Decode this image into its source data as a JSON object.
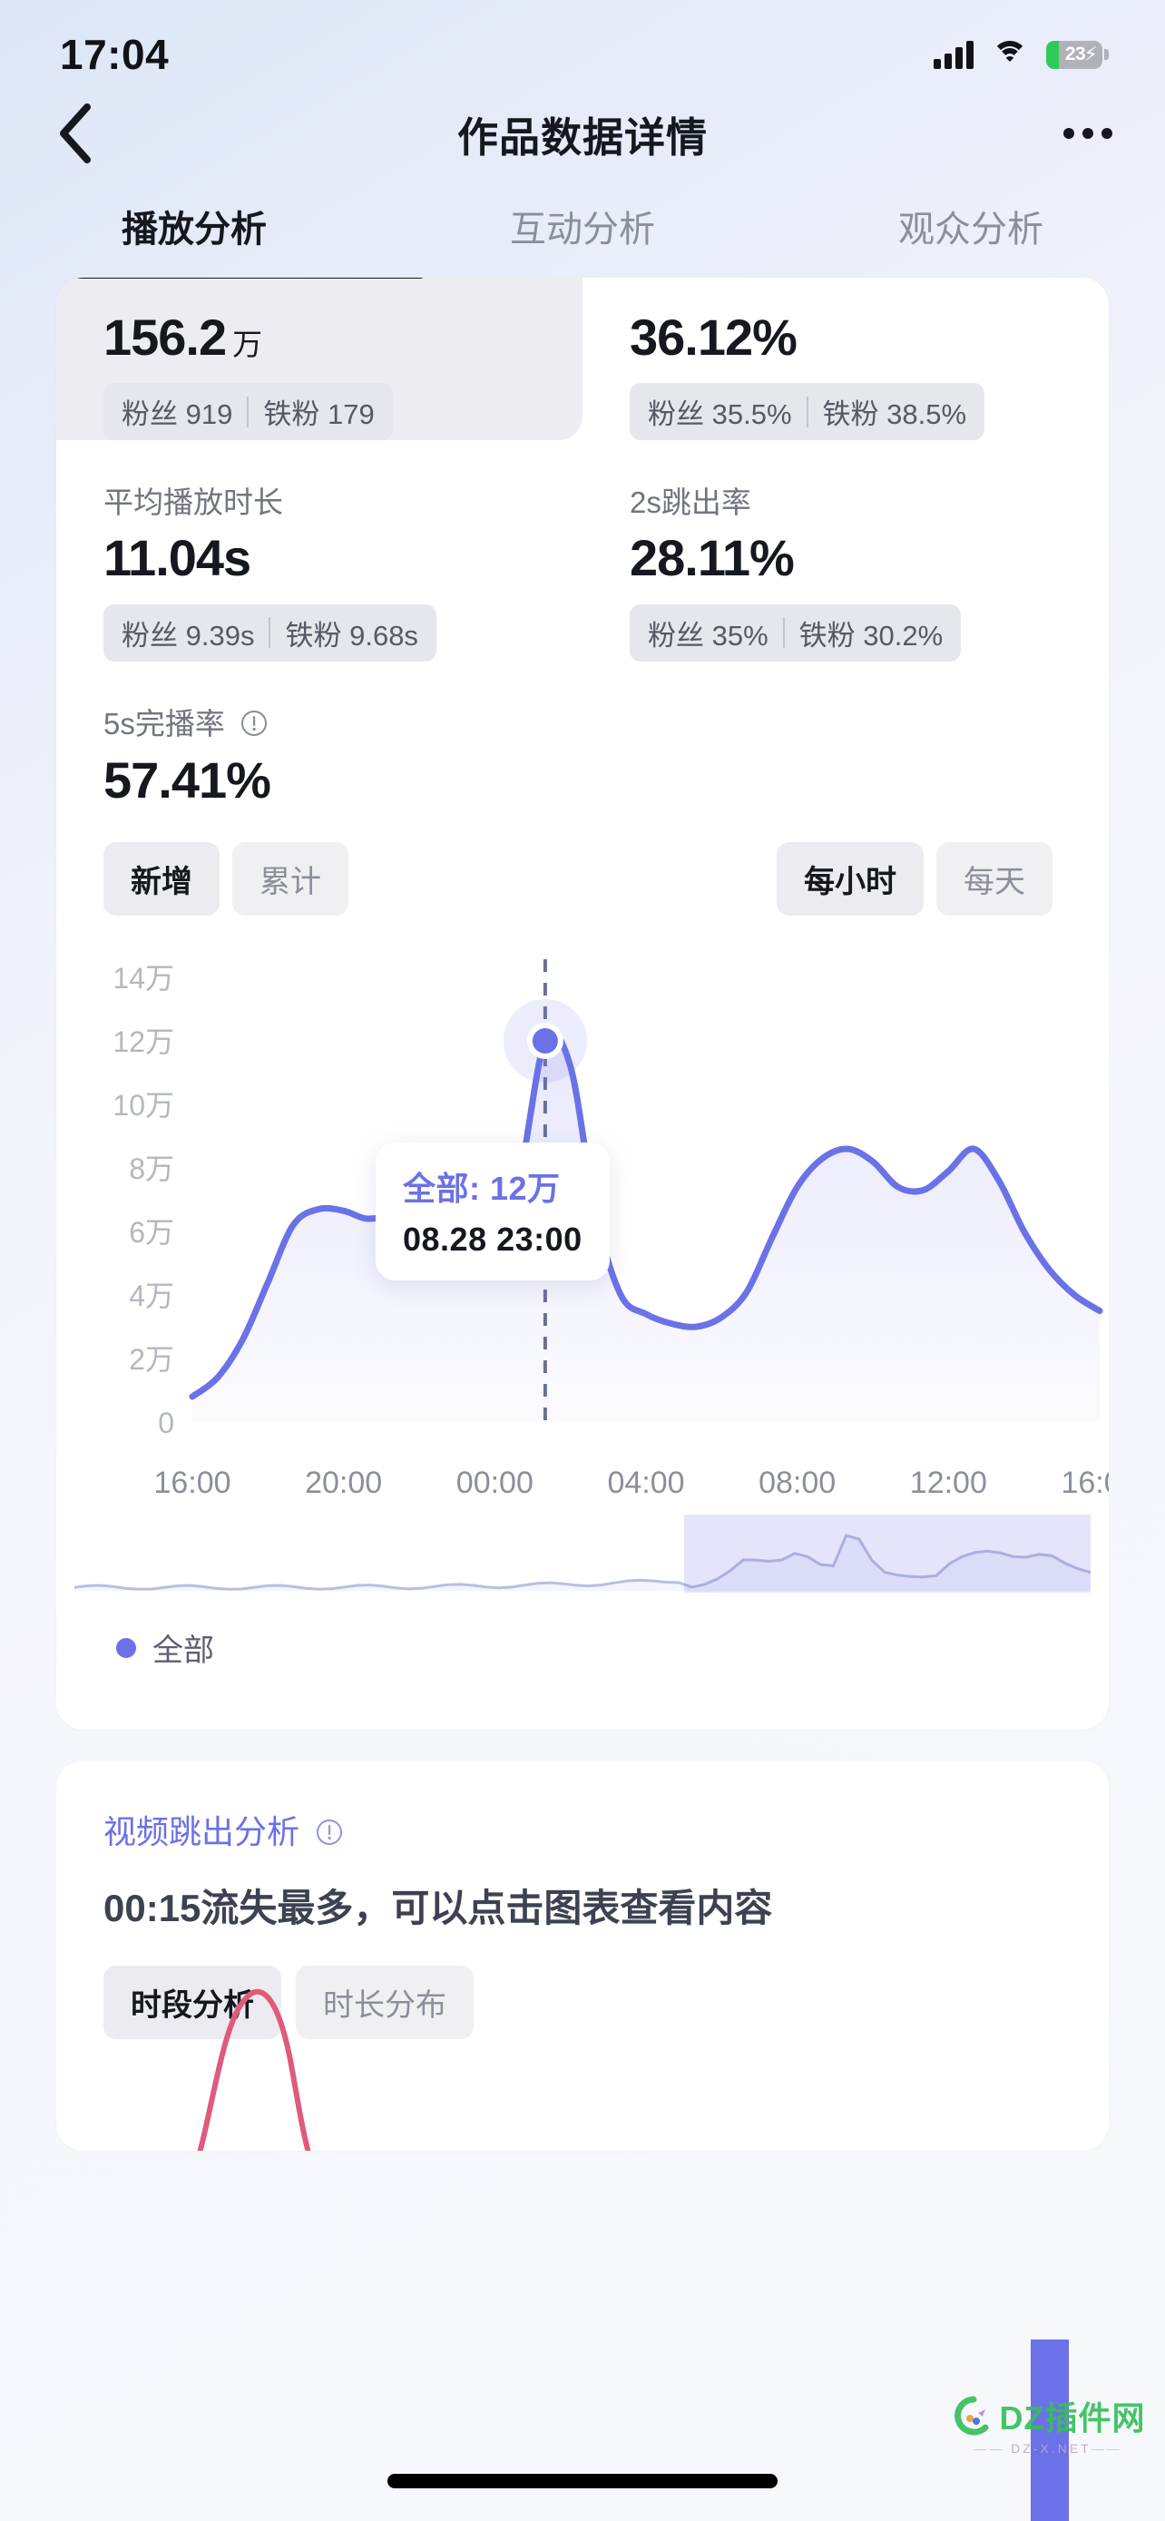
{
  "status_bar": {
    "time": "17:04",
    "battery_percent": "23",
    "battery_level": 23,
    "charging": true,
    "signal_icon": "cellular-signal-icon",
    "wifi_icon": "wifi-icon",
    "battery_icon": "battery-icon"
  },
  "nav": {
    "back_icon": "chevron-left-icon",
    "title": "作品数据详情",
    "more_icon": "more-horizontal-icon"
  },
  "tabs": [
    {
      "label": "播放分析",
      "active": true
    },
    {
      "label": "互动分析",
      "active": false
    },
    {
      "label": "观众分析",
      "active": false
    }
  ],
  "metrics": [
    {
      "label": "",
      "value": "156.2",
      "unit": "万",
      "highlighted": true,
      "chips": [
        {
          "key": "粉丝",
          "value": "919"
        },
        {
          "key": "铁粉",
          "value": "179"
        }
      ]
    },
    {
      "label": "",
      "value": "36.12%",
      "unit": "",
      "highlighted": false,
      "chips": [
        {
          "key": "粉丝",
          "value": "35.5%"
        },
        {
          "key": "铁粉",
          "value": "38.5%"
        }
      ]
    },
    {
      "label": "平均播放时长",
      "value": "11.04s",
      "unit": "",
      "highlighted": false,
      "chips": [
        {
          "key": "粉丝",
          "value": "9.39s"
        },
        {
          "key": "铁粉",
          "value": "9.68s"
        }
      ]
    },
    {
      "label": "2s跳出率",
      "value": "28.11%",
      "unit": "",
      "highlighted": false,
      "chips": [
        {
          "key": "粉丝",
          "value": "35%"
        },
        {
          "key": "铁粉",
          "value": "30.2%"
        }
      ]
    },
    {
      "label": "5s完播率",
      "info_icon": "info-circle-icon",
      "value": "57.41%",
      "unit": "",
      "highlighted": false,
      "chips": []
    }
  ],
  "toggles": {
    "left": [
      {
        "label": "新增",
        "active": true
      },
      {
        "label": "累计",
        "active": false
      }
    ],
    "right": [
      {
        "label": "每小时",
        "active": true
      },
      {
        "label": "每天",
        "active": false
      }
    ]
  },
  "chart_data": {
    "type": "line",
    "title": "",
    "xlabel": "",
    "ylabel": "",
    "series": [
      {
        "name": "全部",
        "color": "#6b71e6",
        "values": [
          8000,
          14000,
          26000,
          44000,
          62000,
          67000,
          66500,
          64000,
          67000,
          81000,
          74000,
          57000,
          54000,
          78000,
          120000,
          112000,
          66000,
          40000,
          34000,
          31000,
          30000,
          33000,
          41000,
          58000,
          74000,
          83000,
          86000,
          82000,
          74000,
          73000,
          79000,
          86000,
          76000,
          60000,
          48000,
          40000,
          35000
        ]
      }
    ],
    "x": [
      "16:00",
      "17:00",
      "18:00",
      "19:00",
      "20:00",
      "21:00",
      "22:00",
      "23:00",
      "00:00",
      "01:00",
      "02:00",
      "03:00",
      "04:00",
      "05:00",
      "06:00",
      "07:00",
      "08:00",
      "09:00",
      "10:00",
      "11:00",
      "12:00",
      "13:00",
      "14:00",
      "15:00",
      "16:00"
    ],
    "xticks": [
      "16:00",
      "20:00",
      "00:00",
      "04:00",
      "08:00",
      "12:00",
      "16:00"
    ],
    "yticks": [
      "0",
      "2万",
      "4万",
      "6万",
      "8万",
      "10万",
      "12万",
      "14万"
    ],
    "ylim": [
      0,
      140000
    ],
    "grid": false,
    "legend": [
      {
        "label": "全部",
        "color": "#6b71e6"
      }
    ],
    "legend_position": "bottom-left",
    "tooltip": {
      "series_label": "全部",
      "value": "12万",
      "timestamp": "08.28 23:00"
    },
    "brush": {
      "selection_start_pct": 60,
      "selection_end_pct": 100
    }
  },
  "bottom_section": {
    "link_label": "视频跳出分析",
    "info_icon": "info-circle-icon",
    "headline": "00:15流失最多，可以点击图表查看内容",
    "buttons": [
      {
        "label": "时段分析",
        "active": true
      },
      {
        "label": "时长分布",
        "active": false
      }
    ]
  },
  "watermark": {
    "text": "DZ插件网",
    "subtext": "DZ-X.NET",
    "logo_icon": "dz-logo-icon"
  },
  "home_indicator": "home-indicator"
}
